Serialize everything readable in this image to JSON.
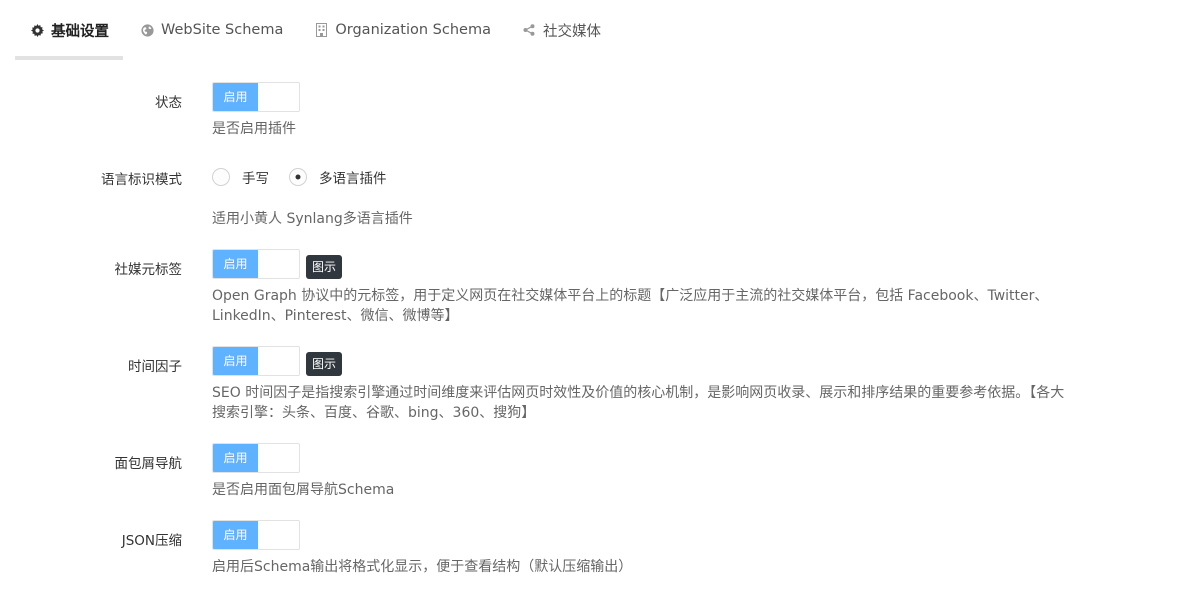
{
  "tabs": [
    {
      "label": "基础设置",
      "icon": "gear-icon",
      "active": true
    },
    {
      "label": "WebSite Schema",
      "icon": "globe-icon",
      "active": false
    },
    {
      "label": "Organization Schema",
      "icon": "building-icon",
      "active": false
    },
    {
      "label": "社交媒体",
      "icon": "share-icon",
      "active": false
    }
  ],
  "switch_on_label": "启用",
  "tip_label": "图示",
  "fields": {
    "status": {
      "label": "状态",
      "help": "是否启用插件"
    },
    "language_mode": {
      "label": "语言标识模式",
      "options": [
        "手写",
        "多语言插件"
      ],
      "selected": "多语言插件",
      "help": "适用小黄人 Synlang多语言插件"
    },
    "social_meta": {
      "label": "社媒元标签",
      "help": "Open Graph 协议中的元标签，用于定义网页在社交媒体平台上的标题【广泛应用于主流的社交媒体平台，包括 Facebook、Twitter、LinkedIn、Pinterest、微信、微博等】"
    },
    "time_factor": {
      "label": "时间因子",
      "help": "SEO 时间因子是指搜索引擎通过时间维度来评估网页时效性及价值的核心机制，是影响网页收录、展示和排序结果的重要参考依据。【各大搜索引擎：头条、百度、谷歌、bing、360、搜狗】"
    },
    "breadcrumb": {
      "label": "面包屑导航",
      "help": "是否启用面包屑导航Schema"
    },
    "json_compress": {
      "label": "JSON压缩",
      "help": "启用后Schema输出将格式化显示，便于查看结构（默认压缩输出）"
    }
  },
  "colors": {
    "accent": "#5eb2ff",
    "tip_bg": "#31373e",
    "tab_underline": "#e2e2e2"
  }
}
